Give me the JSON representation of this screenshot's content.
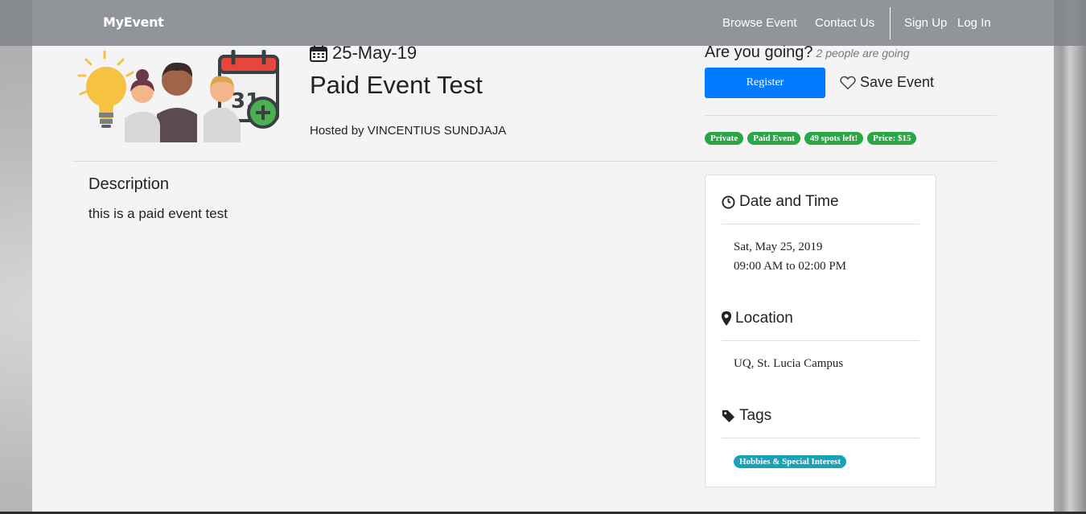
{
  "navbar": {
    "brand": "MyEvent",
    "links": [
      "Browse Event",
      "Contact Us"
    ],
    "auth_links": [
      "Sign Up",
      "Log In"
    ]
  },
  "event": {
    "date": "25-May-19",
    "title": "Paid Event Test",
    "hosted_by": "Hosted by VINCENTIUS SUNDJAJA"
  },
  "attendance": {
    "question": "Are you going?",
    "count_text": "2 people are going",
    "register_label": "Register",
    "save_label": "Save Event"
  },
  "badges": [
    "Private",
    "Paid Event",
    "49 spots left!",
    "Price: $15"
  ],
  "description": {
    "heading": "Description",
    "text": "this is a paid event test"
  },
  "details": {
    "date_time_heading": "Date and Time",
    "date_line": "Sat, May 25, 2019",
    "time_line": "09:00 AM to 02:00 PM",
    "location_heading": "Location",
    "location": "UQ, St. Lucia Campus",
    "tags_heading": "Tags",
    "tags": [
      "Hobbies & Special Interest"
    ]
  },
  "colors": {
    "primary": "#007bff",
    "success": "#28a745",
    "info": "#17a2b8"
  }
}
